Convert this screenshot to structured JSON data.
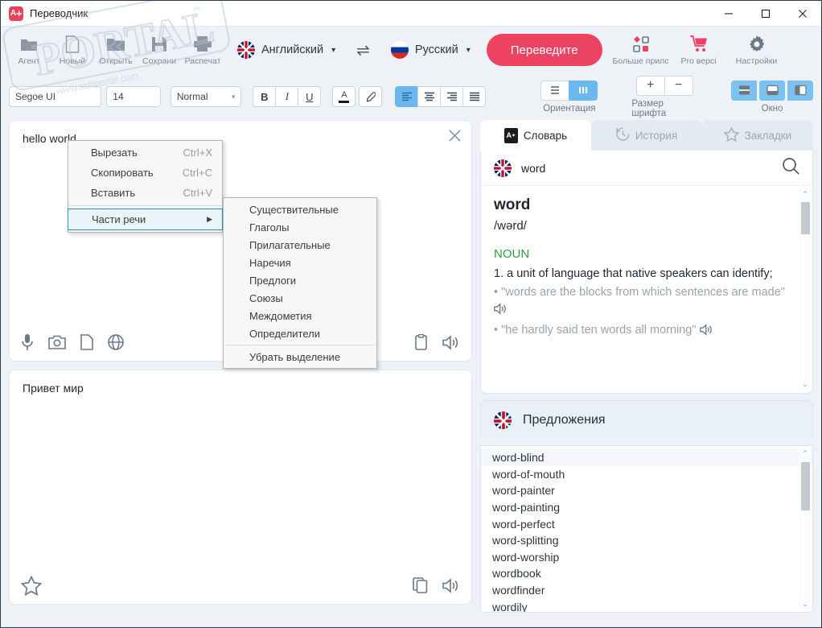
{
  "window": {
    "title": "Переводчик",
    "minimize": "—",
    "maximize": "☐",
    "close": "✕"
  },
  "toolbar": {
    "items": [
      {
        "label": "Агент",
        "icon": "agent-icon"
      },
      {
        "label": "Новый",
        "icon": "new-document-icon"
      },
      {
        "label": "Открыть",
        "icon": "open-folder-icon"
      },
      {
        "label": "Сохрани",
        "icon": "save-icon"
      },
      {
        "label": "Распечат",
        "icon": "print-icon"
      }
    ],
    "source_language": "Английский",
    "target_language": "Русский",
    "swap_icon": "swap-arrows-icon",
    "translate_button": "Переведите",
    "right_items": [
      {
        "label": "Больше прилс",
        "icon": "apps-grid-icon"
      },
      {
        "label": "Pro версі",
        "icon": "cart-icon"
      },
      {
        "label": "Настройки",
        "icon": "gear-icon"
      }
    ],
    "accent_color": "#ec4362"
  },
  "format_bar": {
    "font_family": "Segoe UI",
    "font_size": "14",
    "font_style": "Normal",
    "bold": "B",
    "italic": "I",
    "underline": "U",
    "font_color": "A",
    "highlight": "highlighter-icon",
    "align_left": "align-left-icon",
    "align_center": "align-center-icon",
    "align_right": "align-right-icon",
    "align_justify": "align-justify-icon",
    "orientation_label": "Ориентация",
    "fontsize_label": "Размер шрифта",
    "fontsize_plus": "+",
    "fontsize_minus": "−",
    "window_label": "Окно"
  },
  "editor": {
    "source_text": "hello world",
    "target_text": "Привет мир",
    "clear_icon": "close-icon",
    "source_tools": [
      "microphone-icon",
      "camera-icon",
      "document-icon",
      "globe-icon"
    ],
    "source_right_tools": [
      "clipboard-icon",
      "speaker-icon"
    ],
    "target_left_tools": [
      "star-icon"
    ],
    "target_right_tools": [
      "copy-icon",
      "speaker-icon"
    ]
  },
  "context_menu": {
    "items": [
      {
        "label": "Вырезать",
        "accel": "Ctrl+X",
        "has_submenu": false,
        "selected": false
      },
      {
        "label": "Скопировать",
        "accel": "Ctrl+C",
        "has_submenu": false,
        "selected": false
      },
      {
        "label": "Вставить",
        "accel": "Ctrl+V",
        "has_submenu": false,
        "selected": false
      }
    ],
    "parts_of_speech": {
      "label": "Части речи",
      "arrow": "▶"
    },
    "submenu": [
      "Существительные",
      "Глаголы",
      "Прилагательные",
      "Наречия",
      "Предлоги",
      "Союзы",
      "Междометия",
      "Определители"
    ],
    "submenu_last": "Убрать выделение"
  },
  "right_panel": {
    "tabs": [
      {
        "label": "Словарь",
        "icon": "dictionary-icon",
        "active": true
      },
      {
        "label": "История",
        "icon": "history-clock-icon",
        "active": false
      },
      {
        "label": "Закладки",
        "icon": "star-outline-icon",
        "active": false
      }
    ],
    "search_value": "word",
    "search_icon": "search-icon",
    "flag_icon": "uk-flag-icon",
    "entry": {
      "headword": "word",
      "phonetic": "/wərd/",
      "part_of_speech": "NOUN",
      "pos_color": "#2f9e44",
      "definition": "1. a unit of language that native speakers can identify;",
      "examples": [
        "• \"words are the blocks from which sentences are made\"",
        "• \"he hardly said ten words all morning\""
      ],
      "speaker_icon": "speaker-icon"
    },
    "suggestions_title": "Предложения",
    "suggestions": [
      "word-blind",
      "word-of-mouth",
      "word-painter",
      "word-painting",
      "word-perfect",
      "word-splitting",
      "word-worship",
      "wordbook",
      "wordfinder",
      "wordily"
    ]
  }
}
